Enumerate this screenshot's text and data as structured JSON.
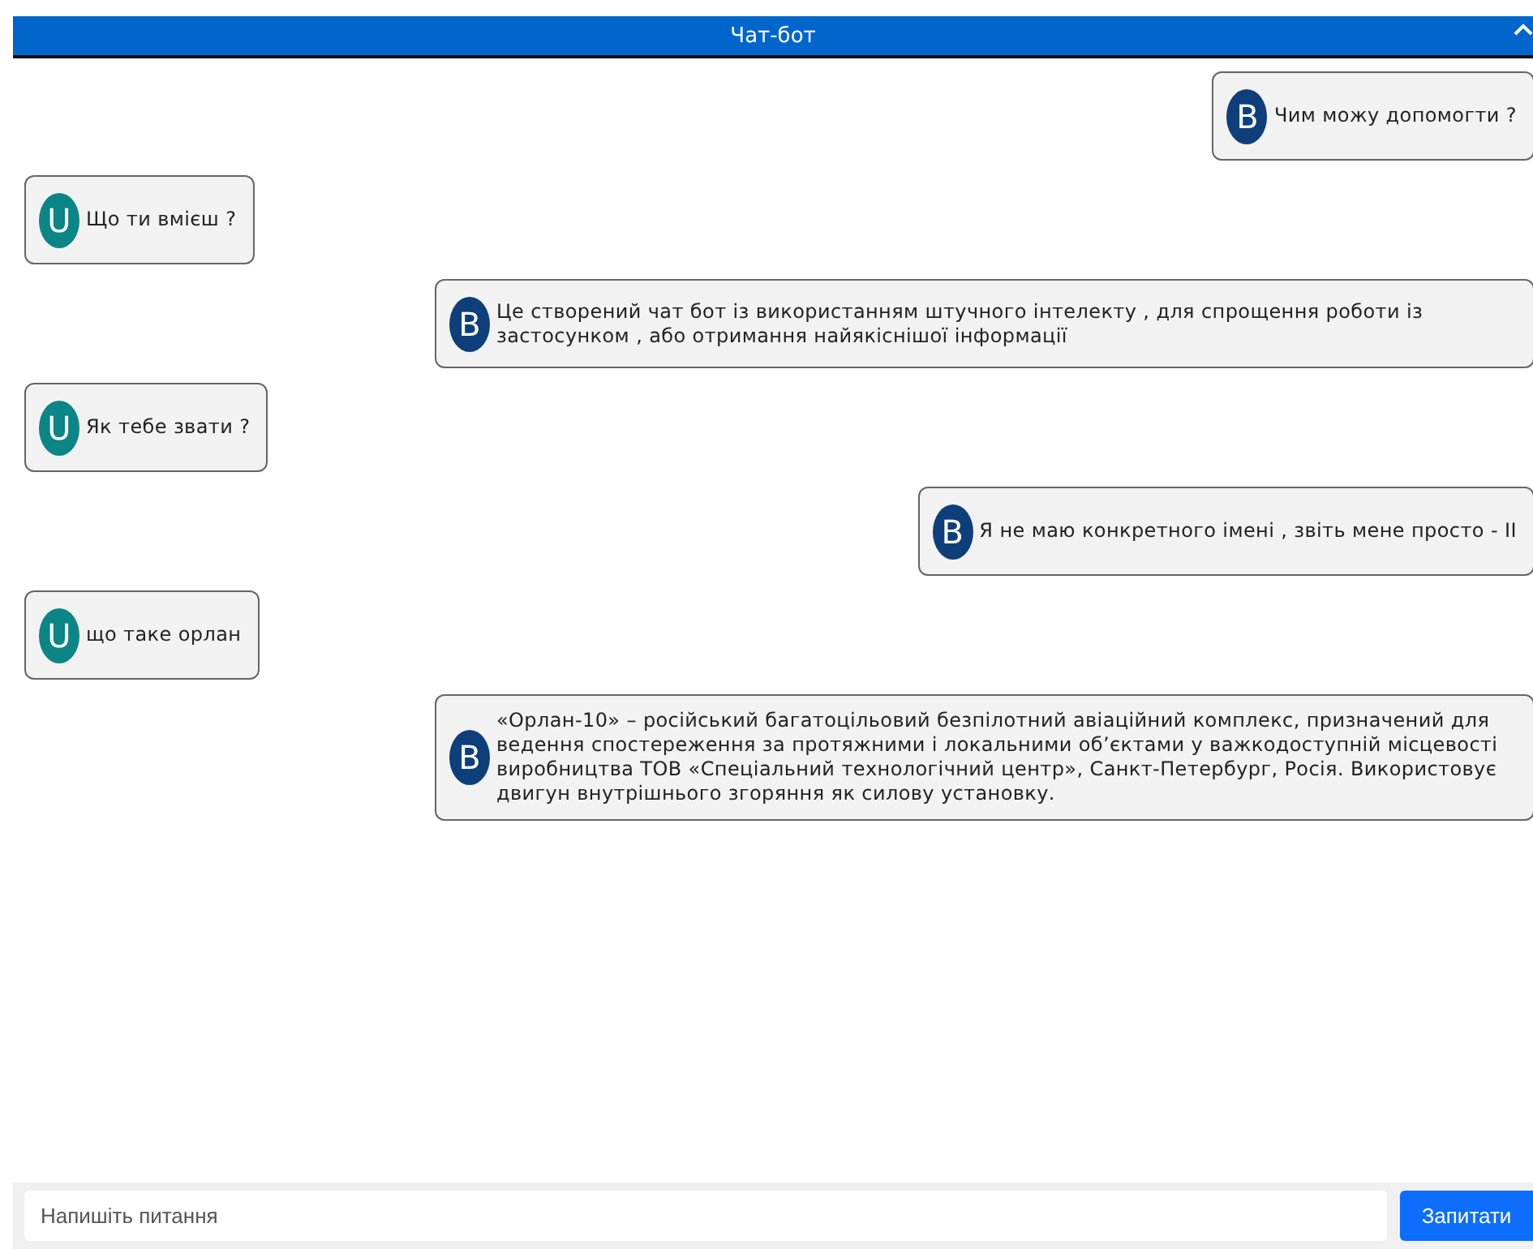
{
  "window": {
    "title": "Чат-бот"
  },
  "messages": [
    {
      "kind": "bot",
      "avatar": "B",
      "text": "Чим можу допомогти ?"
    },
    {
      "kind": "user",
      "avatar": "U",
      "text": "Що ти вмієш ?"
    },
    {
      "kind": "bot",
      "avatar": "B",
      "text": "Це створений чат бот із використанням штучного інтелекту , для спрощення роботи із застосунком , або отримання найякіснішої інформації"
    },
    {
      "kind": "user",
      "avatar": "U",
      "text": "Як тебе звати ?"
    },
    {
      "kind": "bot",
      "avatar": "B",
      "text": "Я не маю конкретного імені , звіть мене просто - ІІ"
    },
    {
      "kind": "user",
      "avatar": "U",
      "text": "що таке орлан"
    },
    {
      "kind": "bot",
      "avatar": "B",
      "text": "«Орлан-10» – російський багатоцільовий безпілотний авіаційний комплекс, призначений для ведення спостереження за протяжними і локальними об’єктами у важкодоступній місцевості виробництва ТОВ «Спеціальний технологічний центр», Санкт-Петербург, Росія. Використовує двигун внутрішнього згоряння як силову установку."
    }
  ],
  "composer": {
    "placeholder": "Напишіть питання",
    "button": "Запитати"
  }
}
